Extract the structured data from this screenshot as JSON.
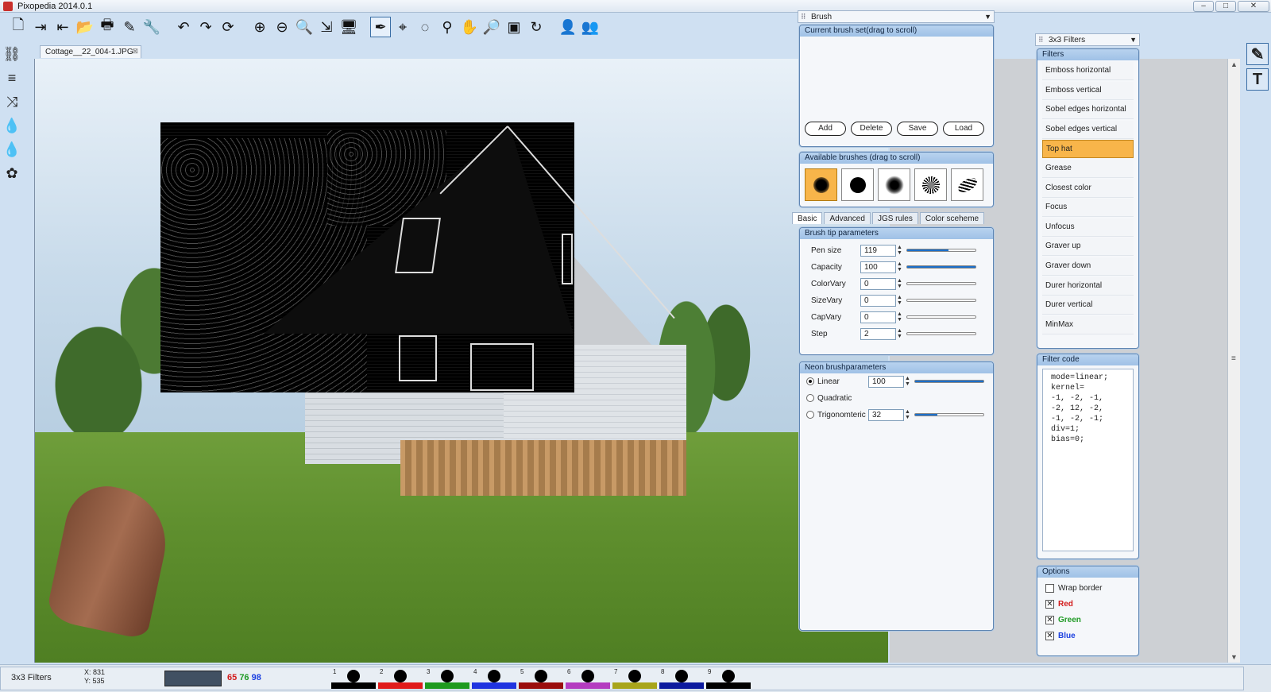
{
  "window": {
    "title": "Pixopedia 2014.0.1",
    "controls": [
      "–",
      "□",
      "✕"
    ]
  },
  "toolbar": {
    "icons": [
      "new-icon",
      "import-icon",
      "export-icon",
      "open-icon",
      "print-icon",
      "brush-tool-icon",
      "settings-icon",
      "undo-icon",
      "redo-icon",
      "refresh-icon",
      "zoom-in-icon",
      "zoom-out-icon",
      "zoom-icon",
      "fit-icon",
      "monitor-icon",
      "pen-icon",
      "crop-icon",
      "lasso-icon",
      "eyedropper-icon",
      "hand-icon",
      "magnifier-icon",
      "transform-icon",
      "rotate-icon",
      "user-icon",
      "user-outline-icon"
    ],
    "glyphs": [
      "🗋",
      "⇥",
      "⇤",
      "📂",
      "🖶",
      "✎",
      "🔧",
      "↶",
      "↷",
      "⟳",
      "⊕",
      "⊖",
      "🔍",
      "⇲",
      "🖥",
      "✒",
      "⌖",
      "◌",
      "⚲",
      "✋",
      "🔎",
      "▣",
      "↻",
      "👤",
      "👥"
    ]
  },
  "left_tools": [
    "⛓",
    "≡",
    "⤨",
    "💧",
    "💧",
    "✿"
  ],
  "right_tools": [
    "✎",
    "T"
  ],
  "document": {
    "tab_label": "Cottage__22_004-1.JPG",
    "close_glyph": "⊠"
  },
  "brush_panel": {
    "selector_label": "Brush",
    "current_set_title": "Current brush set(drag to scroll)",
    "buttons": [
      "Add",
      "Delete",
      "Save",
      "Load"
    ],
    "available_title": "Available brushes (drag to scroll)",
    "tabs": [
      "Basic",
      "Advanced",
      "JGS rules",
      "Color sceheme"
    ],
    "tip_title": "Brush tip parameters",
    "params": [
      {
        "label": "Pen size",
        "value": "119",
        "level": 0.6
      },
      {
        "label": "Capacity",
        "value": "100",
        "level": 1.0
      },
      {
        "label": "ColorVary",
        "value": "0",
        "level": 0
      },
      {
        "label": "SizeVary",
        "value": "0",
        "level": 0
      },
      {
        "label": "CapVary",
        "value": "0",
        "level": 0
      },
      {
        "label": "Step",
        "value": "2",
        "level": 0
      }
    ],
    "neon_title": "Neon brushparameters",
    "neon": [
      {
        "label": "Linear",
        "value": "100",
        "level": 1.0,
        "selected": true
      },
      {
        "label": "Quadratic",
        "value": "",
        "selected": false
      },
      {
        "label": "Trigonomteric",
        "value": "32",
        "level": 0.32,
        "selected": false
      }
    ]
  },
  "filters_panel": {
    "selector_label": "3x3 Filters",
    "filters_title": "Filters",
    "items": [
      "Emboss horizontal",
      "Emboss vertical",
      "Sobel edges horizontal",
      "Sobel edges vertical",
      "Top hat",
      "Grease",
      "Closest color",
      "Focus",
      "Unfocus",
      "Graver up",
      "Graver down",
      "Durer horizontal",
      "Durer vertical",
      "MinMax"
    ],
    "selected": "Top hat",
    "code_title": "Filter code",
    "code": "mode=linear;\nkernel=\n-1, -2, -1,\n-2, 12, -2,\n-1, -2, -1;\ndiv=1;\nbias=0;",
    "options_title": "Options",
    "options": [
      {
        "label": "Wrap border",
        "checked": false,
        "color": "#222222"
      },
      {
        "label": "Red",
        "checked": true,
        "color": "#d21a1a"
      },
      {
        "label": "Green",
        "checked": true,
        "color": "#1f9a25"
      },
      {
        "label": "Blue",
        "checked": true,
        "color": "#1a3fe0"
      }
    ]
  },
  "status": {
    "tool_name": "3x3 Filters",
    "x": "X: 831",
    "y": "Y: 535",
    "color_hex": "#415062",
    "r": "65",
    "g": "76",
    "b": "98",
    "palette": [
      {
        "num": "1",
        "color": "#000000"
      },
      {
        "num": "2",
        "color": "#e01b1b"
      },
      {
        "num": "3",
        "color": "#1e9a1e"
      },
      {
        "num": "4",
        "color": "#1f33e0"
      },
      {
        "num": "5",
        "color": "#9a0d0d"
      },
      {
        "num": "6",
        "color": "#b43cc0"
      },
      {
        "num": "7",
        "color": "#a8a51a"
      },
      {
        "num": "8",
        "color": "#0c1a9e"
      },
      {
        "num": "9",
        "color": "#000000"
      }
    ]
  }
}
